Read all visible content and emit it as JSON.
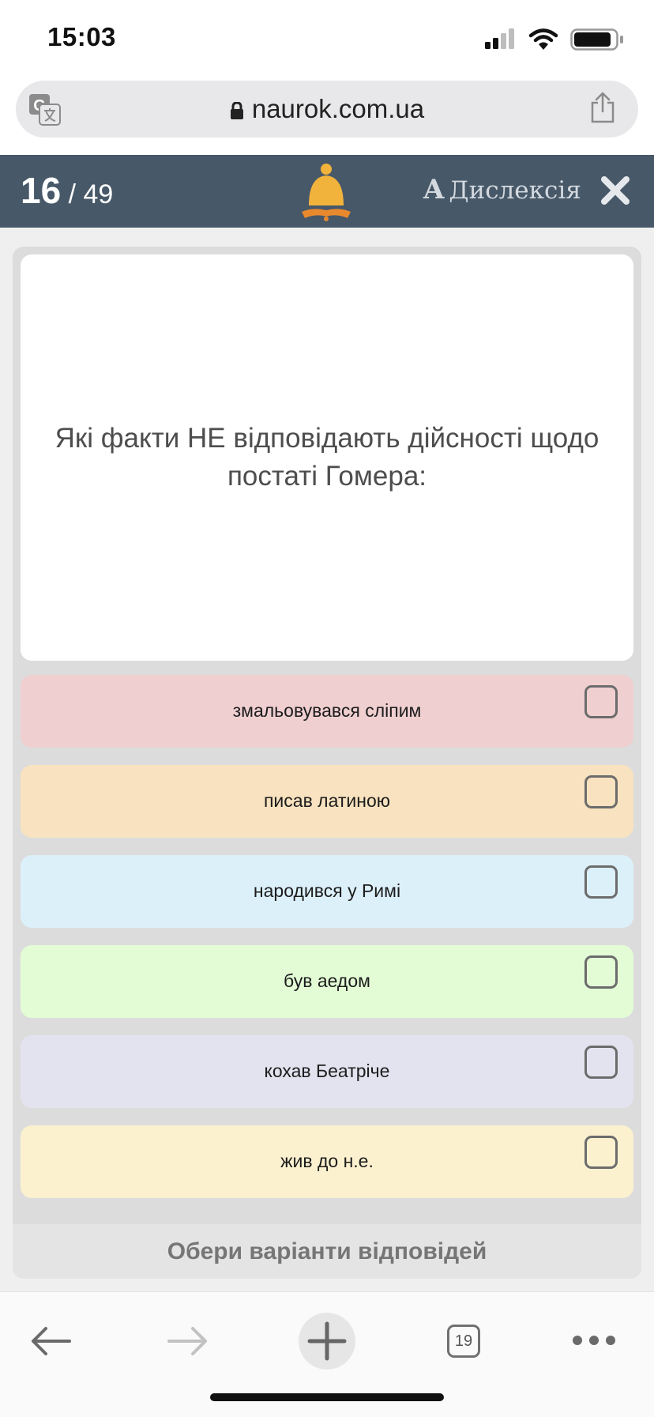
{
  "status_bar": {
    "time": "15:03"
  },
  "browser": {
    "url": "naurok.com.ua",
    "tab_count": "19"
  },
  "quiz": {
    "current": "16",
    "total_text": " / 49",
    "dyslexia_icon": "A",
    "dyslexia_label": "Дислексія",
    "question": "Які факти НЕ відповідають дійсності щодо постаті Гомера:",
    "options": [
      {
        "label": "змальовувався сліпим",
        "color": "#f0cfd0"
      },
      {
        "label": "писав латиною",
        "color": "#f8e2bf"
      },
      {
        "label": "народився у Римі",
        "color": "#dcf0fa"
      },
      {
        "label": "був аедом",
        "color": "#e3fcd6"
      },
      {
        "label": "кохав Беатріче",
        "color": "#e3e3f0"
      },
      {
        "label": "жив до н.е.",
        "color": "#fbf1cf"
      }
    ],
    "submit_label": "Обери варіанти відповідей"
  },
  "colors": {
    "header_bg": "#475868",
    "bell": "#f2b33d",
    "book": "#e9892d"
  },
  "icons": [
    "signal-icon",
    "wifi-icon",
    "battery-icon",
    "translate-icon",
    "lock-icon",
    "share-icon",
    "bell-icon",
    "close-icon",
    "back-arrow-icon",
    "forward-arrow-icon",
    "plus-icon",
    "more-icon"
  ]
}
